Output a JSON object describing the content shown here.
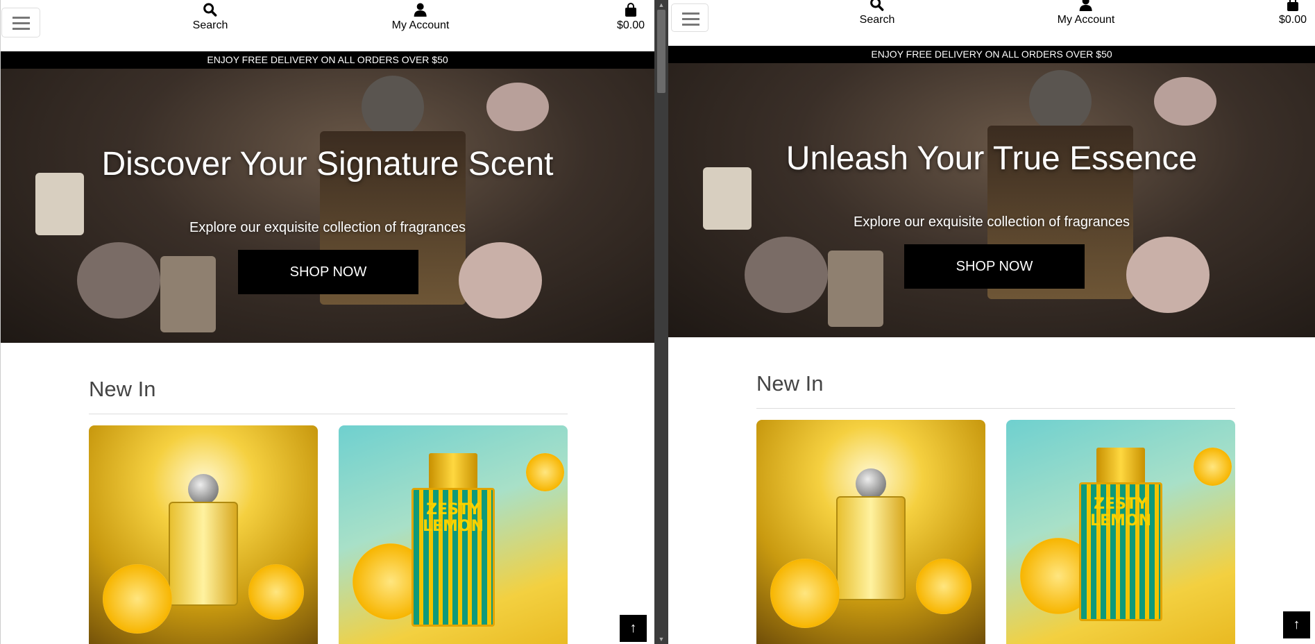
{
  "header": {
    "search_label": "Search",
    "account_label": "My Account",
    "cart_total": "$0.00"
  },
  "banner": "ENJOY FREE DELIVERY ON ALL ORDERS OVER $50",
  "panes": [
    {
      "hero_title": "Discover Your Signature Scent",
      "hero_subtitle": "Explore our exquisite collection of fragrances",
      "cta": "SHOP NOW"
    },
    {
      "hero_title": "Unleash Your True Essence",
      "hero_subtitle": "Explore our exquisite collection of fragrances",
      "cta": "SHOP NOW"
    }
  ],
  "section_title": "New In",
  "products": [
    {
      "image": "golden citrus perfume bottle"
    },
    {
      "image": "Zesty Lemon fragrance bottle",
      "label_lines": [
        "ZESTY",
        "LEMON"
      ]
    }
  ],
  "scroll_top_icon": "arrow-up-icon"
}
